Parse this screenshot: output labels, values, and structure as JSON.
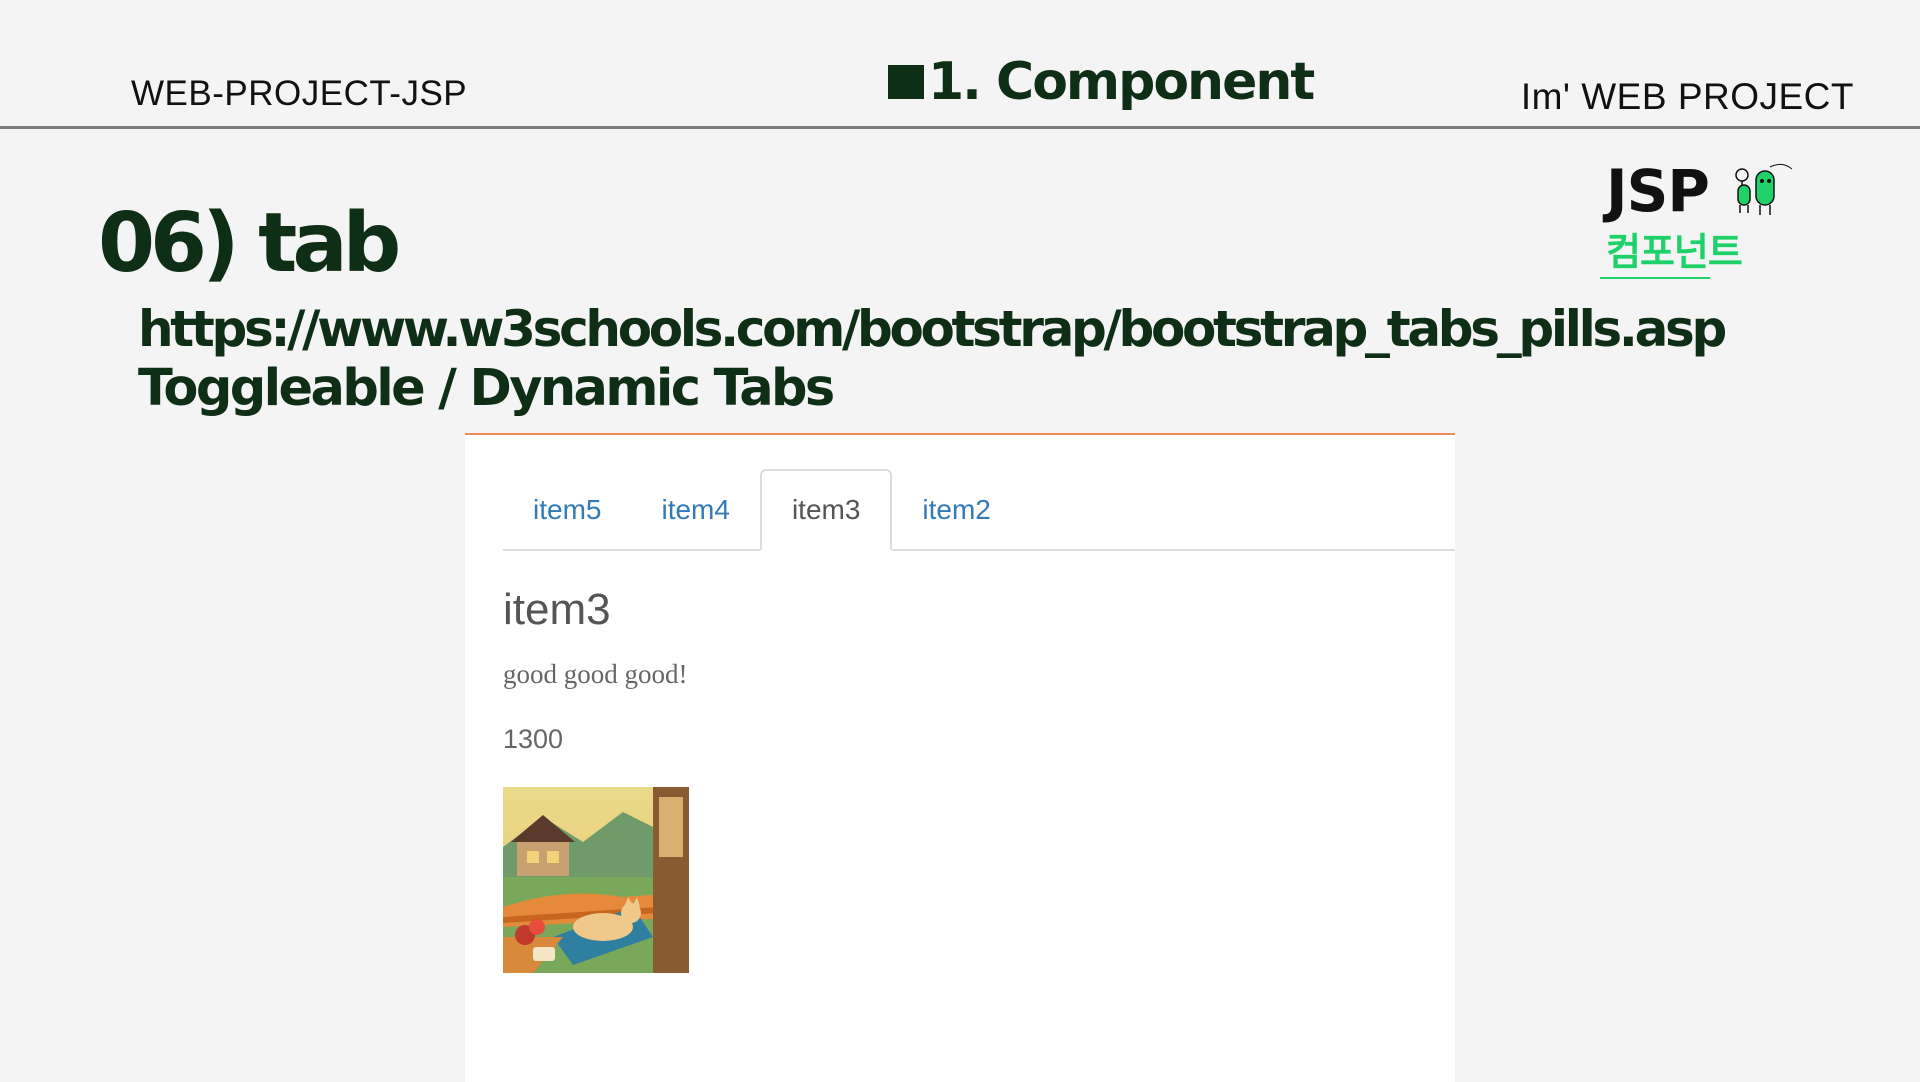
{
  "header": {
    "left": "WEB-PROJECT-JSP",
    "center": "1. Component",
    "right": "Im'  WEB PROJECT"
  },
  "logo": {
    "title": "JSP",
    "subtitle": "컴포넌트"
  },
  "section": {
    "title": "06) tab",
    "url": "https://www.w3schools.com/bootstrap/bootstrap_tabs_pills.asp",
    "subtitle": "Toggleable / Dynamic Tabs"
  },
  "demo": {
    "tabs": [
      {
        "label": "item5",
        "active": false
      },
      {
        "label": "item4",
        "active": false
      },
      {
        "label": "item3",
        "active": true
      },
      {
        "label": "item2",
        "active": false
      }
    ],
    "pane": {
      "title": "item3",
      "text": "good good good!",
      "number": "1300",
      "image_icon": "cat-lounging-chair-village-illustration"
    }
  },
  "colors": {
    "dark_green": "#0f2e16",
    "brand_green": "#1fd169",
    "link_blue": "#337ab7",
    "accent_orange": "#f08a5d"
  }
}
